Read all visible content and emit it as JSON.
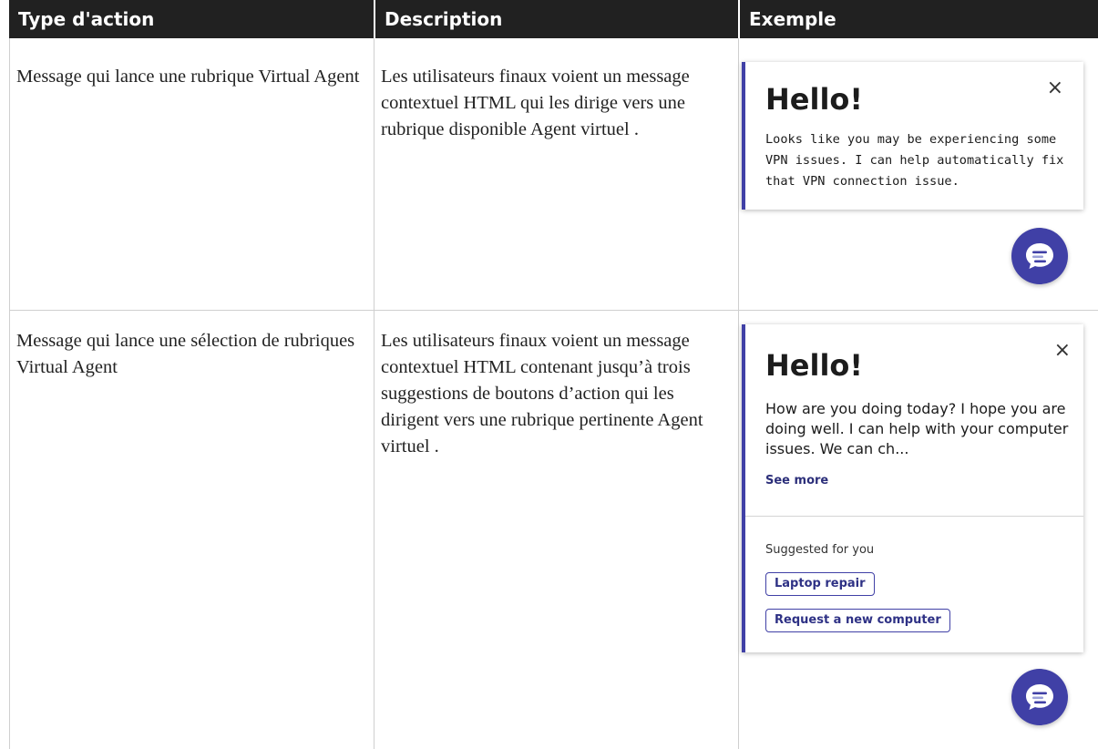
{
  "table": {
    "headers": [
      "Type d'action",
      "Description",
      "Exemple"
    ],
    "rows": [
      {
        "type": "Message qui lance une rubrique Virtual Agent",
        "description": "Les utilisateurs finaux voient un message contextuel HTML qui les dirige vers une rubrique disponible Agent virtuel ."
      },
      {
        "type": "Message qui lance une sélection de rubriques Virtual Agent",
        "description": "Les utilisateurs finaux voient un message contextuel HTML contenant jusqu’à trois suggestions de boutons d’action qui les dirigent vers une rubrique pertinente Agent virtuel ."
      }
    ]
  },
  "example1": {
    "title": "Hello!",
    "close_icon": "×",
    "body": "Looks like you may be experiencing some VPN issues. I can help  automatically fix that VPN connection issue."
  },
  "example2": {
    "title": "Hello!",
    "close_icon": "×",
    "body": "How are you doing today? I hope you are doing well. I can help with your computer issues. We can ch...",
    "see_more": "See more",
    "suggested_label": "Suggested for you",
    "suggestions": [
      "Laptop repair",
      "Request a new computer"
    ]
  },
  "icons": [
    "close-icon",
    "chat-icon"
  ],
  "colors": {
    "header_bg": "#212121",
    "accent": "#4040a6"
  }
}
